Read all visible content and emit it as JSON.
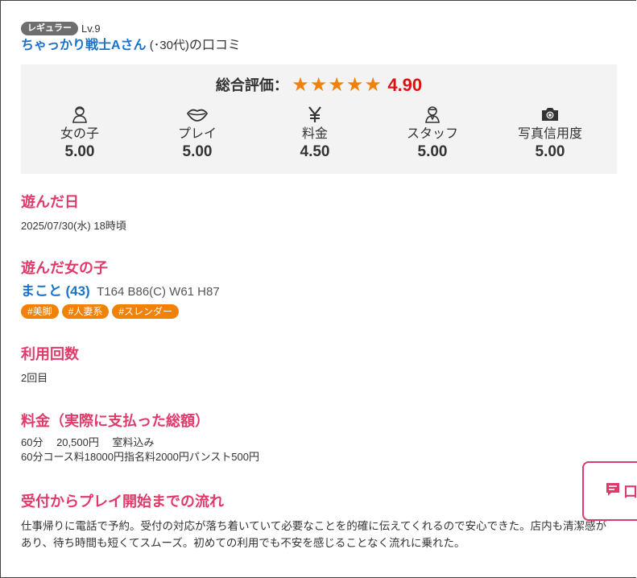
{
  "reviewer": {
    "rank": "レギュラー",
    "level": "Lv.9",
    "name": "ちゃっかり戦士Aさん",
    "age": " (･30代)",
    "suffix": "の口コミ"
  },
  "rating": {
    "overall_label": "総合評価：",
    "stars": "★★★★★",
    "overall_score": "4.90",
    "star_color": "#f0820a",
    "score_color": "#e01010",
    "categories": [
      {
        "label": "女の子",
        "score": "5.00",
        "icon": "woman-icon"
      },
      {
        "label": "プレイ",
        "score": "5.00",
        "icon": "lips-icon"
      },
      {
        "label": "料金",
        "score": "4.50",
        "icon": "yen-icon"
      },
      {
        "label": "スタッフ",
        "score": "5.00",
        "icon": "staff-icon"
      },
      {
        "label": "写真信用度",
        "score": "5.00",
        "icon": "camera-icon"
      }
    ]
  },
  "visit_date": {
    "title": "遊んだ日",
    "value": "2025/07/30(水) 18時頃"
  },
  "girl": {
    "title": "遊んだ女の子",
    "name": "まこと",
    "age": "(43)",
    "stats": "T164 B86(C) W61 H87",
    "tags": [
      "#美脚",
      "#人妻系",
      "#スレンダー"
    ]
  },
  "usage": {
    "title": "利用回数",
    "value": "2回目"
  },
  "price": {
    "title": "料金（実際に支払った総額）",
    "line1": "60分　 20,500円　 室料込み",
    "line2": "60分コース料18000円指名料2000円パンスト500円"
  },
  "flow": {
    "title": "受付からプレイ開始までの流れ",
    "text": "仕事帰りに電話で予約。受付の対応が落ち着いていて必要なことを的確に伝えてくれるので安心できた。店内も清潔感があり、待ち時間も短くてスムーズ。初めての利用でも不安を感じることなく流れに乗れた。"
  },
  "float_button": {
    "label": "口",
    "accent": "#e03a6a"
  }
}
